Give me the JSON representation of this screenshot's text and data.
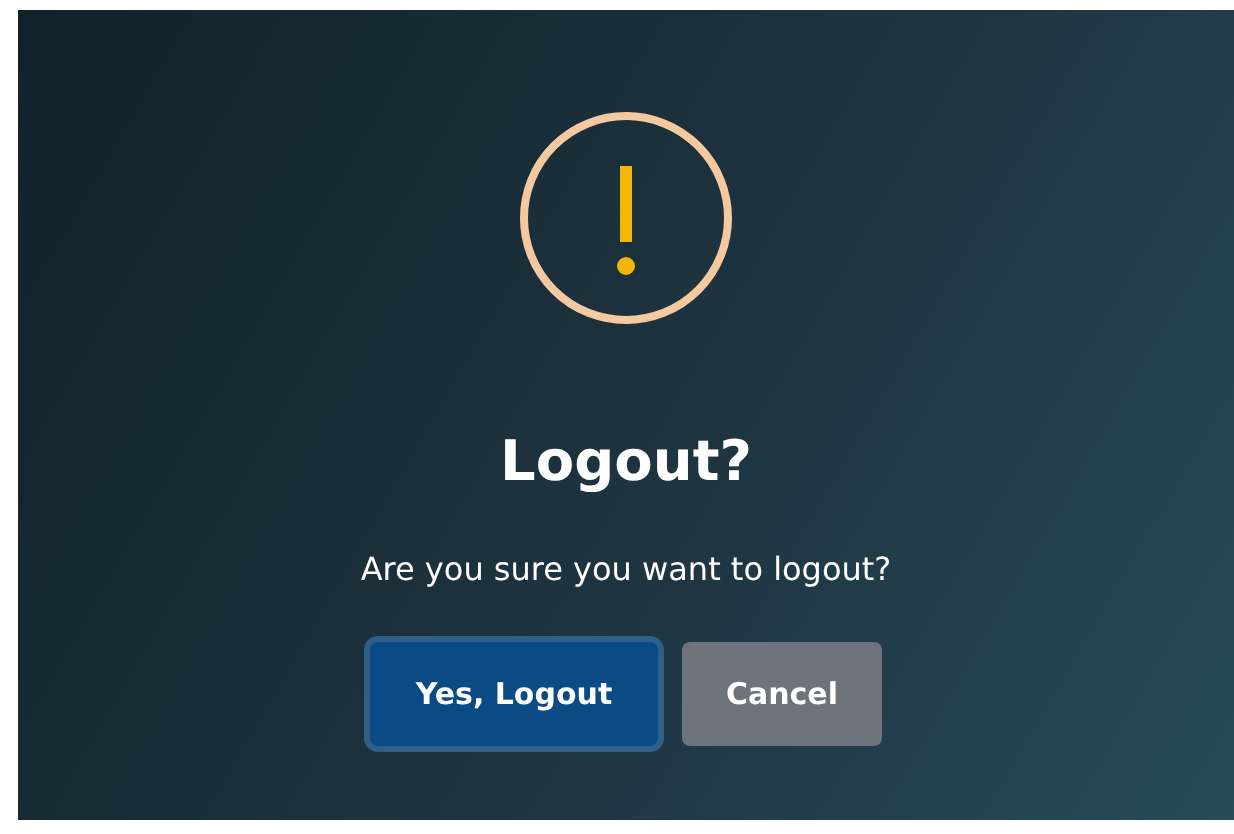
{
  "dialog": {
    "title": "Logout?",
    "message": "Are you sure you want to logout?",
    "buttons": [
      {
        "label": "Yes, Logout",
        "kind": "primary",
        "focused": true
      },
      {
        "label": "Cancel",
        "kind": "secondary",
        "focused": false
      }
    ]
  }
}
